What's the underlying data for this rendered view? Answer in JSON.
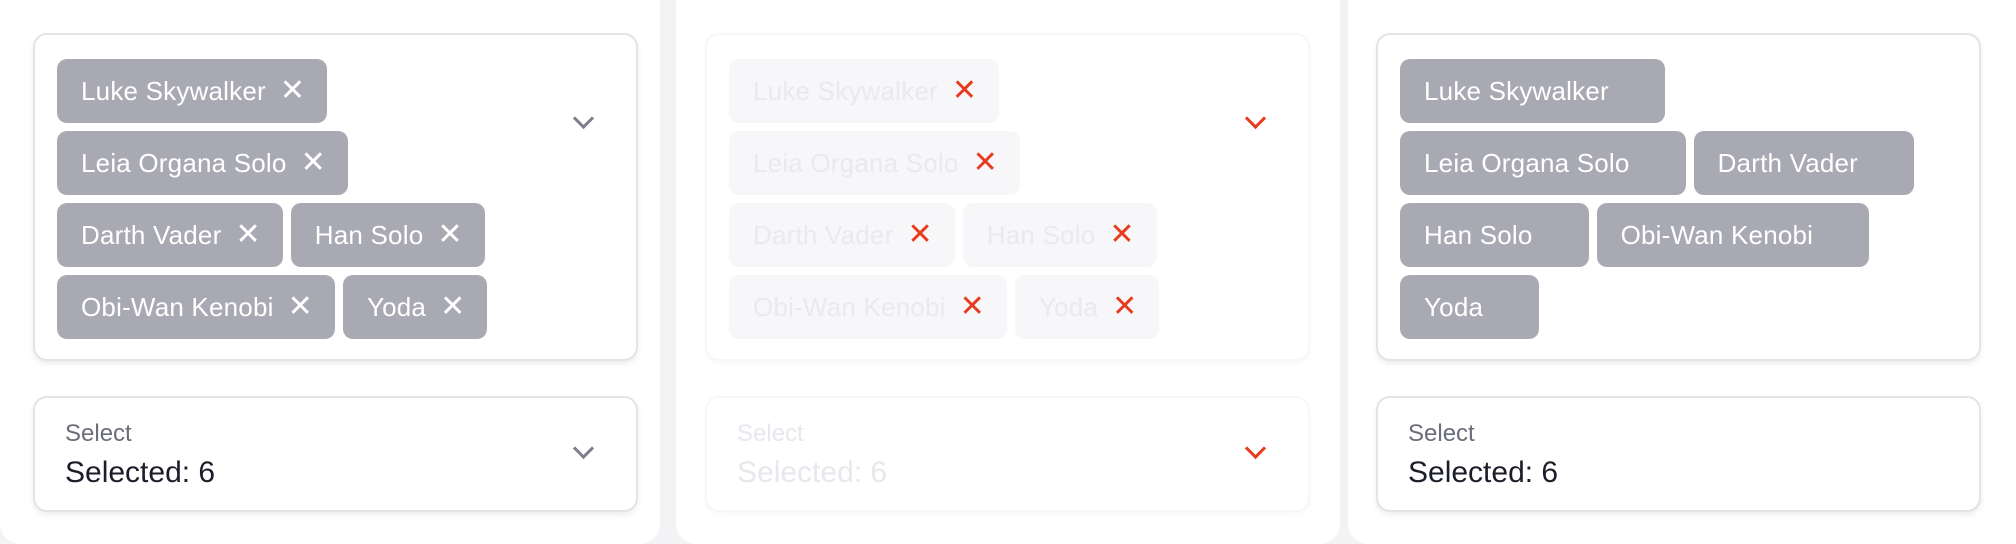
{
  "chips": [
    "Luke Skywalker",
    "Leia Organa Solo",
    "Darth Vader",
    "Han Solo",
    "Obi-Wan Kenobi",
    "Yoda"
  ],
  "close_glyph": "✕",
  "select": {
    "label": "Select",
    "value": "Selected: 6"
  },
  "colors": {
    "chip_bg": "#a8a9b3",
    "disabled_accent": "#e63b1f",
    "border": "#e3e3e8",
    "value_text": "#1b1d2a"
  },
  "icons": {
    "remove": "close-icon",
    "dropdown": "chevron-down-icon"
  }
}
